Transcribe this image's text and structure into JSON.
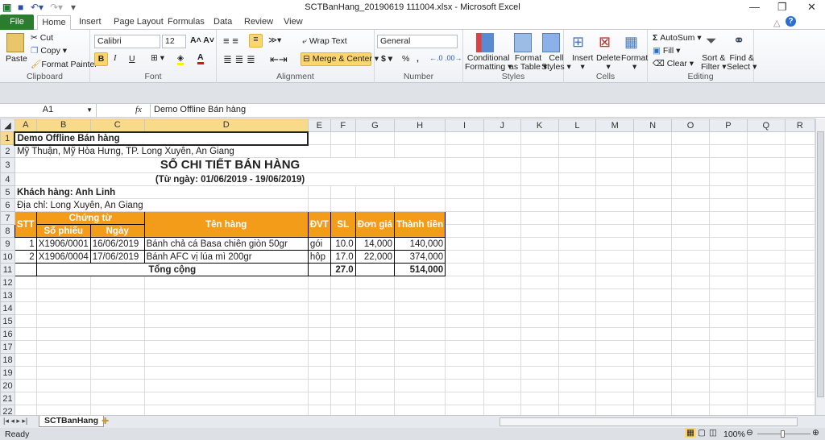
{
  "window": {
    "title": "SCTBanHang_20190619 111004.xlsx  -  Microsoft Excel",
    "minimize": "—",
    "restore": "❐",
    "close": "✕"
  },
  "tabs": [
    "File",
    "Home",
    "Insert",
    "Page Layout",
    "Formulas",
    "Data",
    "Review",
    "View"
  ],
  "ribbon": {
    "clipboard": {
      "label": "Clipboard",
      "paste": "Paste",
      "cut": "Cut",
      "copy": "Copy",
      "format_painter": "Format Painter"
    },
    "font": {
      "label": "Font",
      "name": "Calibri",
      "size": "12",
      "bold": "B",
      "italic": "I",
      "underline": "U",
      "color_glyph": "A"
    },
    "alignment": {
      "label": "Alignment",
      "wrap": "Wrap Text",
      "merge": "Merge & Center"
    },
    "number": {
      "label": "Number",
      "format": "General",
      "currency": "$",
      "percent": "%",
      "comma": ","
    },
    "styles": {
      "label": "Styles",
      "conditional": [
        "Conditional",
        "Formatting ▾"
      ],
      "table": [
        "Format",
        "as Table ▾"
      ],
      "cell": [
        "Cell",
        "Styles ▾"
      ]
    },
    "cells": {
      "label": "Cells",
      "insert": "Insert",
      "delete": "Delete",
      "format": "Format"
    },
    "editing": {
      "label": "Editing",
      "autosum": "AutoSum ▾",
      "fill": "Fill ▾",
      "clear": "Clear ▾",
      "sort": [
        "Sort &",
        "Filter ▾"
      ],
      "find": [
        "Find &",
        "Select ▾"
      ]
    }
  },
  "formula_bar": {
    "name_box": "A1",
    "fx": "fx",
    "value": "Demo Offline Bán hàng"
  },
  "columns": [
    "A",
    "B",
    "C",
    "D",
    "E",
    "F",
    "G",
    "H",
    "I",
    "J",
    "K",
    "L",
    "M",
    "N",
    "O",
    "P",
    "Q",
    "R"
  ],
  "sheet": {
    "company": "Demo Offline Bán hàng",
    "address": "Mỹ Thuận, Mỹ Hòa Hưng, TP. Long Xuyên, An Giang",
    "title": "SỔ CHI TIẾT BÁN HÀNG",
    "period": "(Từ ngày: 01/06/2019 - 19/06/2019)",
    "customer": "Khách hàng: Anh Linh",
    "customer_address": "Địa chỉ: Long Xuyên, An Giang",
    "headers": {
      "stt": "STT",
      "voucher": "Chứng từ",
      "voucher_no": "Số phiếu",
      "date": "Ngày",
      "item": "Tên hàng",
      "unit": "ĐVT",
      "qty": "SL",
      "price": "Đơn giá",
      "amount": "Thành tiền"
    },
    "rows": [
      {
        "stt": "1",
        "no": "X1906/0001",
        "date": "16/06/2019",
        "item": "Bánh chả cá Basa chiên giòn 50gr",
        "unit": "gói",
        "qty": "10.0",
        "price": "14,000",
        "amount": "140,000"
      },
      {
        "stt": "2",
        "no": "X1906/0004",
        "date": "17/06/2019",
        "item": "Bánh AFC vị lúa mì 200gr",
        "unit": "hộp",
        "qty": "17.0",
        "price": "22,000",
        "amount": "374,000"
      }
    ],
    "total": {
      "label": "Tổng cộng",
      "qty": "27.0",
      "amount": "514,000"
    },
    "header_color": "#f39c1a"
  },
  "sheet_tabs": [
    "SCTBanHang"
  ],
  "status": {
    "ready": "Ready",
    "zoom": "100%"
  }
}
